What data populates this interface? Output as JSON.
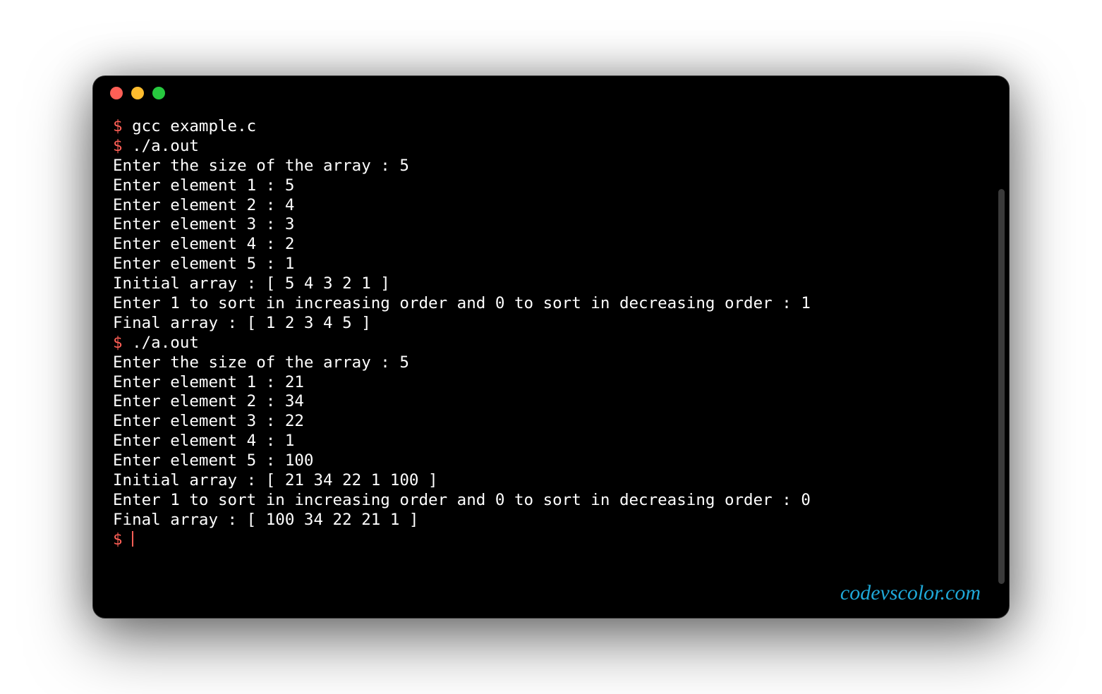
{
  "watermark": "codevscolor.com",
  "prompt_symbol": "$",
  "lines": [
    {
      "prompt": true,
      "text": "gcc example.c"
    },
    {
      "prompt": true,
      "text": "./a.out"
    },
    {
      "prompt": false,
      "text": "Enter the size of the array : 5"
    },
    {
      "prompt": false,
      "text": "Enter element 1 : 5"
    },
    {
      "prompt": false,
      "text": "Enter element 2 : 4"
    },
    {
      "prompt": false,
      "text": "Enter element 3 : 3"
    },
    {
      "prompt": false,
      "text": "Enter element 4 : 2"
    },
    {
      "prompt": false,
      "text": "Enter element 5 : 1"
    },
    {
      "prompt": false,
      "text": "Initial array : [ 5 4 3 2 1 ]"
    },
    {
      "prompt": false,
      "text": "Enter 1 to sort in increasing order and 0 to sort in decreasing order : 1"
    },
    {
      "prompt": false,
      "text": "Final array : [ 1 2 3 4 5 ]"
    },
    {
      "prompt": true,
      "text": "./a.out"
    },
    {
      "prompt": false,
      "text": "Enter the size of the array : 5"
    },
    {
      "prompt": false,
      "text": "Enter element 1 : 21"
    },
    {
      "prompt": false,
      "text": "Enter element 2 : 34"
    },
    {
      "prompt": false,
      "text": "Enter element 3 : 22"
    },
    {
      "prompt": false,
      "text": "Enter element 4 : 1"
    },
    {
      "prompt": false,
      "text": "Enter element 5 : 100"
    },
    {
      "prompt": false,
      "text": "Initial array : [ 21 34 22 1 100 ]"
    },
    {
      "prompt": false,
      "text": "Enter 1 to sort in increasing order and 0 to sort in decreasing order : 0"
    },
    {
      "prompt": false,
      "text": "Final array : [ 100 34 22 21 1 ]"
    },
    {
      "prompt": true,
      "text": "",
      "cursor": true
    }
  ]
}
